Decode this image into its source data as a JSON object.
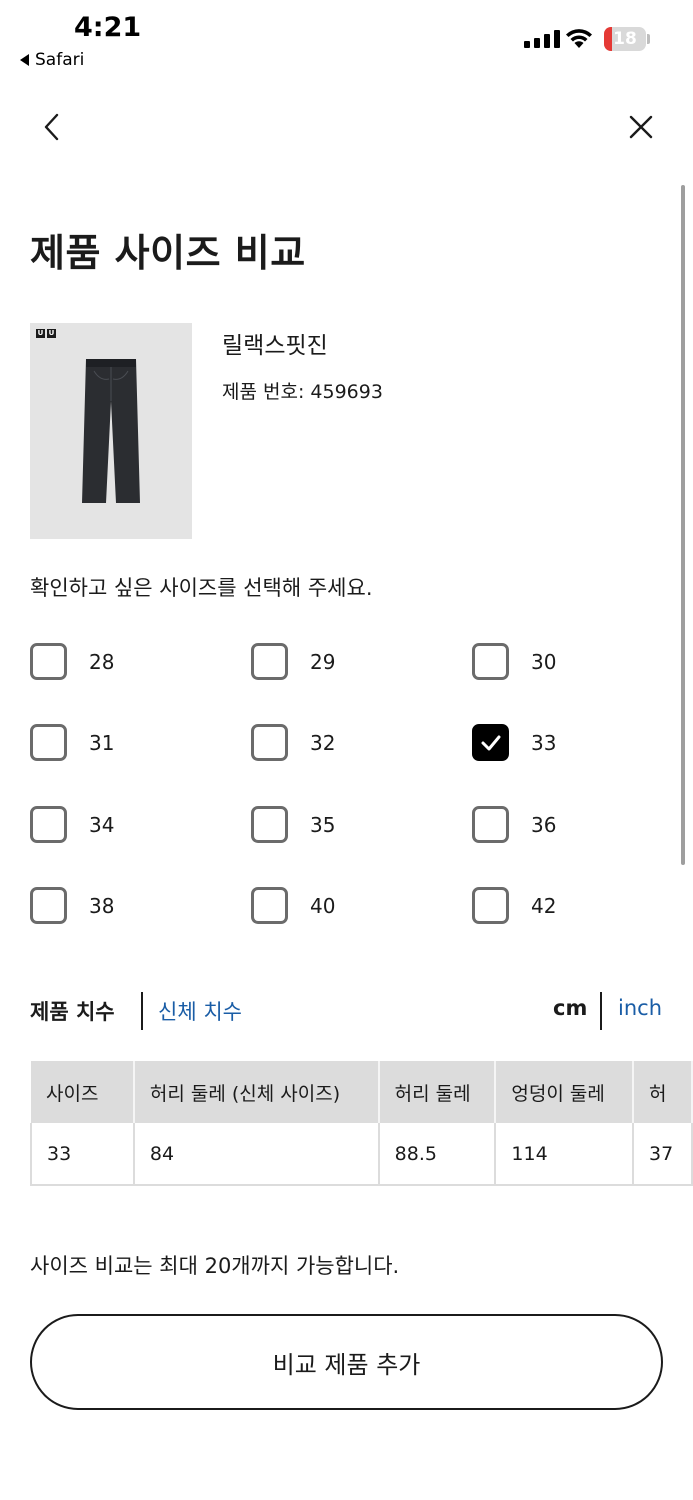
{
  "status_bar": {
    "time": "4:21",
    "back_app": "Safari",
    "battery": "18",
    "battery_color": "#e53935"
  },
  "header": {
    "back_icon": "chevron-left-icon",
    "close_icon": "close-icon"
  },
  "page": {
    "title": "제품 사이즈 비교"
  },
  "product": {
    "name": "릴랙스핏진",
    "number": "제품 번호: 459693",
    "logo": [
      "U",
      "U"
    ]
  },
  "size_selector": {
    "instruction": "확인하고 싶은 사이즈를 선택해 주세요.",
    "options": [
      {
        "label": "28",
        "checked": false
      },
      {
        "label": "29",
        "checked": false
      },
      {
        "label": "30",
        "checked": false
      },
      {
        "label": "31",
        "checked": false
      },
      {
        "label": "32",
        "checked": false
      },
      {
        "label": "33",
        "checked": true
      },
      {
        "label": "34",
        "checked": false
      },
      {
        "label": "35",
        "checked": false
      },
      {
        "label": "36",
        "checked": false
      },
      {
        "label": "38",
        "checked": false
      },
      {
        "label": "40",
        "checked": false
      },
      {
        "label": "42",
        "checked": false
      }
    ]
  },
  "tabs": {
    "product_measure": "제품 치수",
    "body_measure": "신체 치수",
    "unit_cm": "cm",
    "unit_inch": "inch",
    "link_color": "#1a5da6"
  },
  "table": {
    "headers": [
      "사이즈",
      "허리 둘레 (신체 사이즈)",
      "허리 둘레",
      "엉덩이 둘레",
      "허"
    ],
    "row": [
      "33",
      "84",
      "88.5",
      "114",
      "37"
    ]
  },
  "footer": {
    "note": "사이즈 비교는 최대 20개까지 가능합니다.",
    "add_button": "비교 제품 추가"
  }
}
